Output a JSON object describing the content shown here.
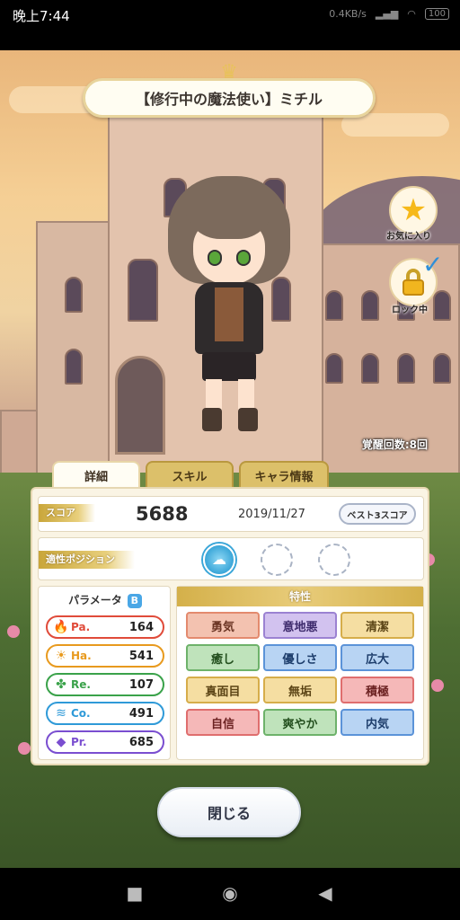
{
  "status_bar": {
    "time": "晚上7:44",
    "net_speed": "0.4KB/s",
    "battery": "100"
  },
  "card": {
    "title": "【修行中の魔法使い】ミチル",
    "favorite_label": "お気に入り",
    "lock_label": "ロック中",
    "awaken_text": "覚醒回数:8回"
  },
  "tabs": [
    {
      "label": "詳細",
      "active": true
    },
    {
      "label": "スキル",
      "active": false
    },
    {
      "label": "キャラ情報",
      "active": false
    }
  ],
  "score": {
    "label": "スコア",
    "value": "5688",
    "date": "2019/11/27",
    "best_button": "ベスト3スコア"
  },
  "position": {
    "label": "適性ポジション",
    "slots_filled": 1,
    "slots_total": 3
  },
  "parameters": {
    "heading": "パラメータ",
    "rank": "B",
    "items": [
      {
        "name": "Pa.",
        "value": "164",
        "icon": "flame-icon",
        "color": "#e04b3a"
      },
      {
        "name": "Ha.",
        "value": "541",
        "icon": "sun-icon",
        "color": "#e89a1e"
      },
      {
        "name": "Re.",
        "value": "107",
        "icon": "clover-icon",
        "color": "#3aa24a"
      },
      {
        "name": "Co.",
        "value": "491",
        "icon": "wind-icon",
        "color": "#2f9ad8"
      },
      {
        "name": "Pr.",
        "value": "685",
        "icon": "diamond-icon",
        "color": "#7a4ed0"
      }
    ]
  },
  "traits": {
    "heading": "特性",
    "items": [
      {
        "label": "勇気",
        "color": "orange"
      },
      {
        "label": "意地悪",
        "color": "purple"
      },
      {
        "label": "清潔",
        "color": "yellow"
      },
      {
        "label": "癒し",
        "color": "green"
      },
      {
        "label": "優しさ",
        "color": "blue"
      },
      {
        "label": "広大",
        "color": "blue"
      },
      {
        "label": "真面目",
        "color": "yellow"
      },
      {
        "label": "無垢",
        "color": "yellow"
      },
      {
        "label": "積極",
        "color": "red"
      },
      {
        "label": "自信",
        "color": "red"
      },
      {
        "label": "爽やか",
        "color": "green"
      },
      {
        "label": "内気",
        "color": "blue"
      }
    ]
  },
  "close_button": "閉じる",
  "colors": {
    "accent_gold": "#d4b04a",
    "panel_bg": "#faf4e4"
  }
}
